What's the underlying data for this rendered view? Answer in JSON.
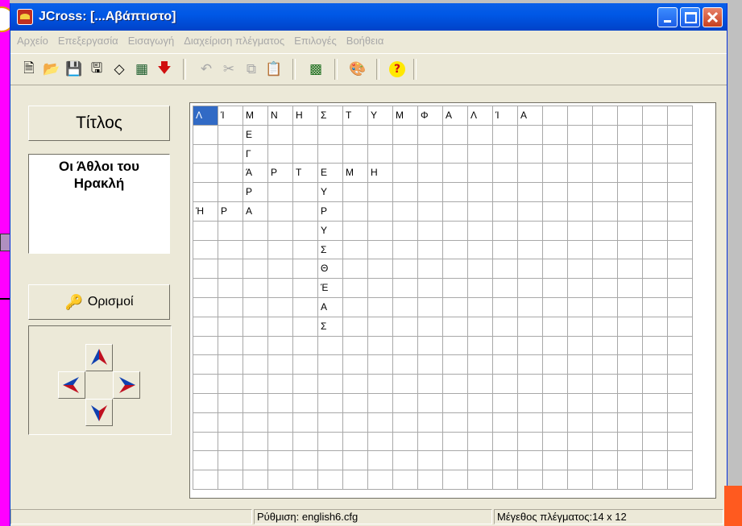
{
  "window": {
    "title": "JCross: [...Αβάπτιστο]",
    "accent": "#0058e6"
  },
  "menu": [
    "Αρχείο",
    "Επεξεργασία",
    "Εισαγωγή",
    "Διαχείριση πλέγματος",
    "Επιλογές",
    "Βοήθεια"
  ],
  "toolbar": {
    "new_icon": "new-file-icon",
    "new_glyph": "🗎",
    "open_icon": "open-folder-icon",
    "open_glyph": "📂",
    "save_icon": "save-icon",
    "save_glyph": "💾",
    "saveas_icon": "save-as-icon",
    "saveas_glyph": "🖫",
    "eraser_icon": "eraser-icon",
    "eraser_glyph": "◇",
    "grid_icon": "crossword-icon",
    "grid_glyph": "▦",
    "export_icon": "export-arrow-icon",
    "export_glyph": "🡇",
    "undo_icon": "undo-icon",
    "undo_glyph": "↶",
    "cut_icon": "cut-icon",
    "cut_glyph": "✂",
    "copy_icon": "copy-icon",
    "copy_glyph": "⧉",
    "paste_icon": "paste-icon",
    "paste_glyph": "📋",
    "webpage_icon": "make-web-page-icon",
    "webpage_glyph": "▩",
    "config_icon": "configuration-icon",
    "config_glyph": "🎨",
    "help_icon": "help-icon",
    "help_glyph": "?"
  },
  "left_panel": {
    "title_label": "Τίτλος",
    "title_line1": "Οι Άθλοι του",
    "title_line2": "Ηρακλή",
    "clues_label": "Ορισμοί",
    "key_glyph": "🔑"
  },
  "grid": {
    "columns": 20,
    "rows": 20,
    "selected_row": 0,
    "selected_col": 0,
    "cells": [
      {
        "r": 0,
        "c": 0,
        "t": "Λ"
      },
      {
        "r": 0,
        "c": 1,
        "t": "Ί"
      },
      {
        "r": 0,
        "c": 2,
        "t": "Μ"
      },
      {
        "r": 0,
        "c": 3,
        "t": "Ν"
      },
      {
        "r": 0,
        "c": 4,
        "t": "Η"
      },
      {
        "r": 0,
        "c": 5,
        "t": "Σ"
      },
      {
        "r": 0,
        "c": 6,
        "t": "Τ"
      },
      {
        "r": 0,
        "c": 7,
        "t": "Υ"
      },
      {
        "r": 0,
        "c": 8,
        "t": "Μ"
      },
      {
        "r": 0,
        "c": 9,
        "t": "Φ"
      },
      {
        "r": 0,
        "c": 10,
        "t": "Α"
      },
      {
        "r": 0,
        "c": 11,
        "t": "Λ"
      },
      {
        "r": 0,
        "c": 12,
        "t": "Ί"
      },
      {
        "r": 0,
        "c": 13,
        "t": "Α"
      },
      {
        "r": 1,
        "c": 2,
        "t": "Ε"
      },
      {
        "r": 2,
        "c": 2,
        "t": "Γ"
      },
      {
        "r": 3,
        "c": 2,
        "t": "Ά"
      },
      {
        "r": 3,
        "c": 3,
        "t": "Ρ"
      },
      {
        "r": 3,
        "c": 4,
        "t": "Τ"
      },
      {
        "r": 3,
        "c": 5,
        "t": "Ε"
      },
      {
        "r": 3,
        "c": 6,
        "t": "Μ"
      },
      {
        "r": 3,
        "c": 7,
        "t": "Η"
      },
      {
        "r": 4,
        "c": 2,
        "t": "Ρ"
      },
      {
        "r": 4,
        "c": 5,
        "t": "Υ"
      },
      {
        "r": 5,
        "c": 0,
        "t": "Ή"
      },
      {
        "r": 5,
        "c": 1,
        "t": "Ρ"
      },
      {
        "r": 5,
        "c": 2,
        "t": "Α"
      },
      {
        "r": 5,
        "c": 5,
        "t": "Ρ"
      },
      {
        "r": 6,
        "c": 5,
        "t": "Υ"
      },
      {
        "r": 7,
        "c": 5,
        "t": "Σ"
      },
      {
        "r": 8,
        "c": 5,
        "t": "Θ"
      },
      {
        "r": 9,
        "c": 5,
        "t": "Έ"
      },
      {
        "r": 10,
        "c": 5,
        "t": "Α"
      },
      {
        "r": 11,
        "c": 5,
        "t": "Σ"
      }
    ]
  },
  "status": {
    "config": "Ρύθμιση: english6.cfg",
    "grid_size": "Μέγεθος πλέγματος:14 x 12"
  }
}
